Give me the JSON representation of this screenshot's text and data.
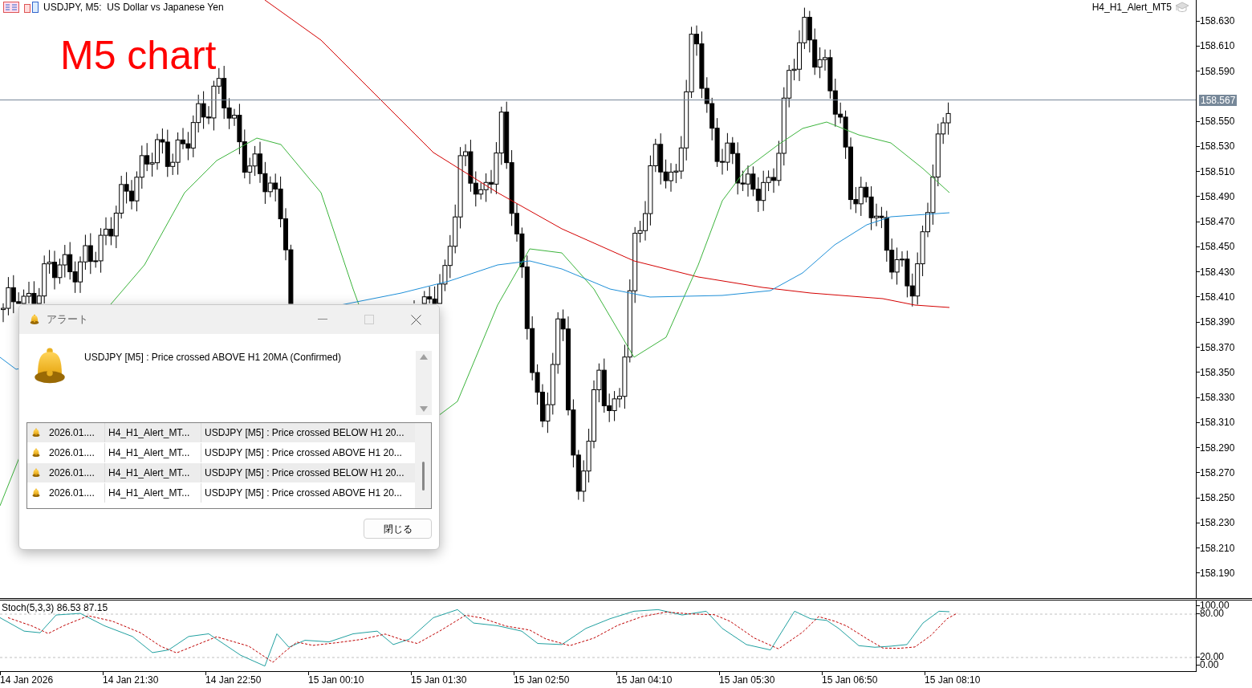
{
  "chart": {
    "title": "USDJPY, M5:  US Dollar vs Japanese Yen",
    "overlay_label": "M5 chart",
    "expert": "H4_H1_Alert_MT5",
    "current_price": "158.567",
    "price_ticks": [
      "158.630",
      "158.610",
      "158.590",
      "158.550",
      "158.530",
      "158.510",
      "158.490",
      "158.470",
      "158.450",
      "158.430",
      "158.410",
      "158.390",
      "158.370",
      "158.350",
      "158.330",
      "158.310",
      "158.290",
      "158.270",
      "158.250",
      "158.230",
      "158.210",
      "158.190"
    ]
  },
  "stochastic": {
    "label": "Stoch(5,3,3) 86.53 87.15",
    "ticks": [
      "100.00",
      "80.00",
      "20.00",
      "0.00"
    ]
  },
  "time_axis": [
    "14 Jan 2026",
    "14 Jan 21:30",
    "14 Jan 22:50",
    "15 Jan 00:10",
    "15 Jan 01:30",
    "15 Jan 02:50",
    "15 Jan 04:10",
    "15 Jan 05:30",
    "15 Jan 06:50",
    "15 Jan 08:10"
  ],
  "alert_dialog": {
    "title": "アラート",
    "message": "USDJPY [M5] : Price crossed ABOVE H1 20MA (Confirmed)",
    "close_button": "閉じる",
    "rows": [
      {
        "time": "2026.01....",
        "expert": "H4_H1_Alert_MT...",
        "message": "USDJPY [M5] : Price crossed BELOW H1 20..."
      },
      {
        "time": "2026.01....",
        "expert": "H4_H1_Alert_MT...",
        "message": "USDJPY [M5] : Price crossed ABOVE H1 20..."
      },
      {
        "time": "2026.01....",
        "expert": "H4_H1_Alert_MT...",
        "message": "USDJPY [M5] : Price crossed BELOW H1 20..."
      },
      {
        "time": "2026.01....",
        "expert": "H4_H1_Alert_MT...",
        "message": "USDJPY [M5] : Price crossed ABOVE H1 20..."
      }
    ]
  }
}
